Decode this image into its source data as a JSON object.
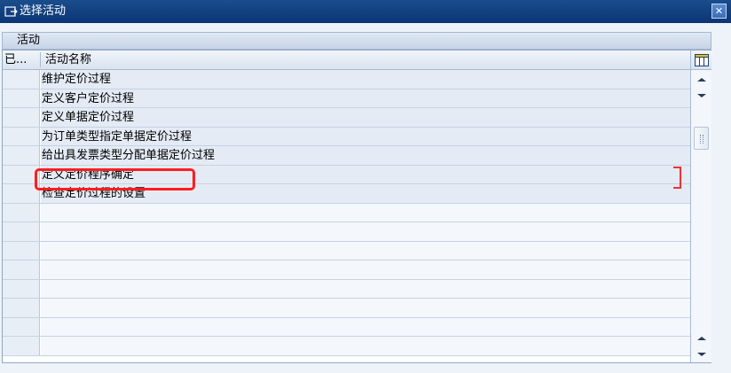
{
  "window": {
    "title": "选择活动",
    "close_label": "✕"
  },
  "grid": {
    "title": "活动",
    "columns": [
      "已...",
      "活动名称"
    ],
    "rows": [
      {
        "name": "维护定价过程"
      },
      {
        "name": "定义客户定价过程"
      },
      {
        "name": "定义单据定价过程"
      },
      {
        "name": "为订单类型指定单据定价过程"
      },
      {
        "name": "给出具发票类型分配单据定价过程"
      },
      {
        "name": "定义定价程序确定"
      },
      {
        "name": "检查定价过程的设置"
      }
    ],
    "empty_row_count": 8
  },
  "colors": {
    "titlebar": "#0c3574",
    "highlight": "#ff1e1e",
    "row_bg": "#e4ebf5"
  },
  "icons": {
    "window": "window-icon",
    "settings": "table-settings-icon",
    "scroll_up": "arrow-up-icon",
    "scroll_down": "arrow-down-icon"
  }
}
